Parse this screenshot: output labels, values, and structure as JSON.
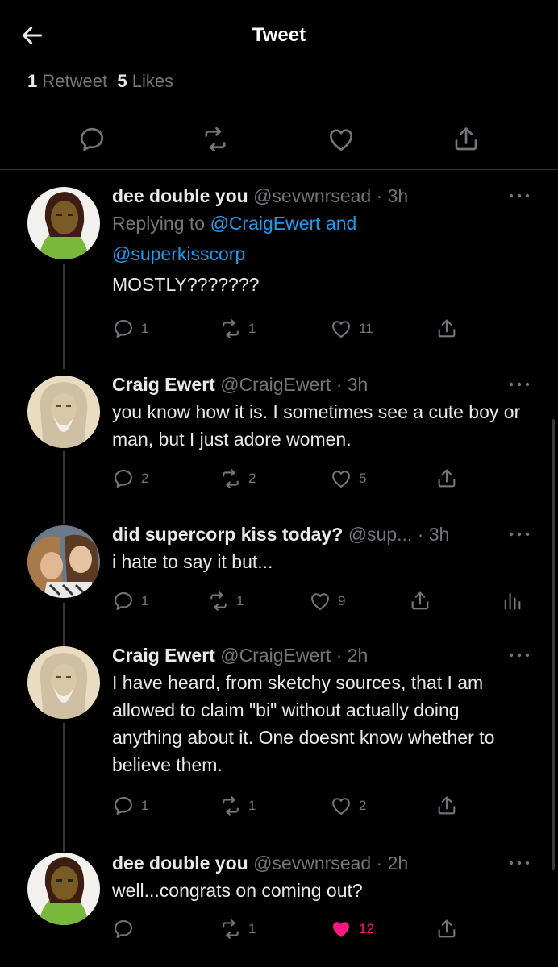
{
  "header": {
    "title": "Tweet"
  },
  "stats": {
    "retweets_count": "1",
    "retweets_label": "Retweet",
    "likes_count": "5",
    "likes_label": "Likes"
  },
  "tweets": [
    {
      "name": "dee double you",
      "handle": "@sevwnrsead",
      "time": "· 3h",
      "reply_prefix": "Replying to",
      "reply_mentions": "@CraigEwert and",
      "reply_mentions2": "@superkisscorp",
      "text": "MOSTLY???????",
      "replies": "1",
      "retweets": "1",
      "likes": "11"
    },
    {
      "name": "Craig Ewert",
      "handle": "@CraigEwert",
      "time": "· 3h",
      "text": "you know how it is.  I sometimes see a cute boy or man, but I just adore women.",
      "replies": "2",
      "retweets": "2",
      "likes": "5"
    },
    {
      "name": "did supercorp kiss today?",
      "handle": "@sup...",
      "time": "· 3h",
      "text": "i hate to say it but...",
      "replies": "1",
      "retweets": "1",
      "likes": "9"
    },
    {
      "name": "Craig Ewert",
      "handle": "@CraigEwert",
      "time": "· 2h",
      "text": "I have heard, from sketchy sources, that I am allowed to claim \"bi\" without actually doing anything about it.  One doesnt know whether to believe them.",
      "replies": "1",
      "retweets": "1",
      "likes": "2"
    },
    {
      "name": "dee double you",
      "handle": "@sevwnrsead",
      "time": "· 2h",
      "text": "well...congrats on coming out?",
      "retweets": "1",
      "likes": "12"
    }
  ],
  "colors": {
    "background": "#000000",
    "muted": "#71767b",
    "link": "#1d9bf0",
    "like_active": "#f91880"
  },
  "icons": {
    "back": "arrow-left-icon",
    "reply": "comment-icon",
    "retweet": "retweet-icon",
    "like": "heart-icon",
    "share": "share-icon",
    "more": "ellipsis-icon",
    "analytics": "analytics-icon"
  }
}
